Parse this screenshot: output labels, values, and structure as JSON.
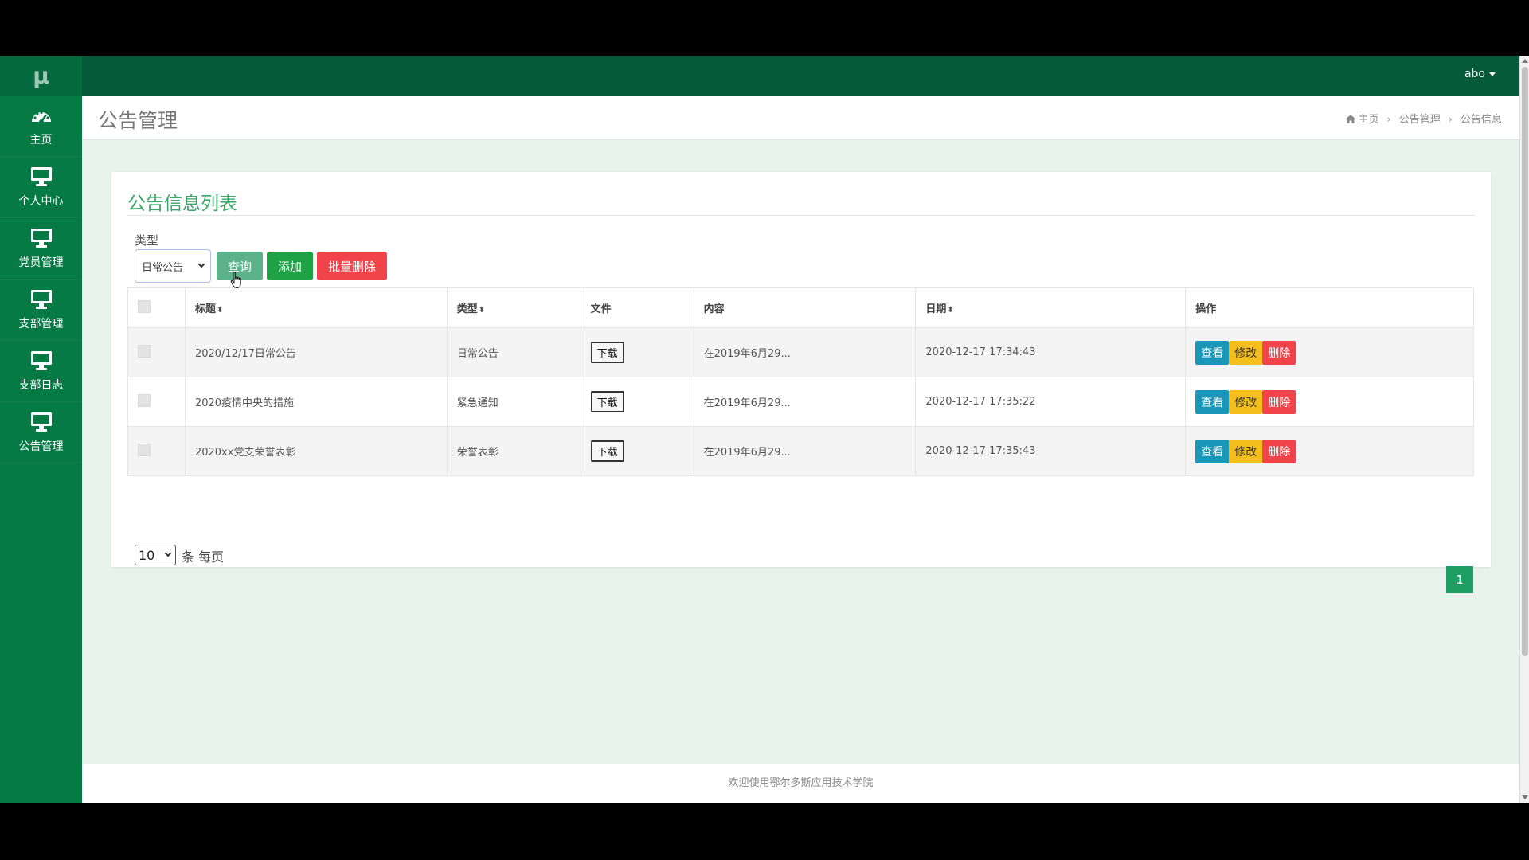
{
  "app": {
    "logo": "μ",
    "user": "abo"
  },
  "sidebar": {
    "items": [
      {
        "label": "主页",
        "icon": "dashboard-icon"
      },
      {
        "label": "个人中心",
        "icon": "monitor-icon"
      },
      {
        "label": "党员管理",
        "icon": "monitor-icon"
      },
      {
        "label": "支部管理",
        "icon": "monitor-icon"
      },
      {
        "label": "支部日志",
        "icon": "monitor-icon"
      },
      {
        "label": "公告管理",
        "icon": "monitor-icon"
      }
    ]
  },
  "header": {
    "title": "公告管理",
    "breadcrumb": [
      "主页",
      "公告管理",
      "公告信息"
    ]
  },
  "card": {
    "title": "公告信息列表",
    "filter_label": "类型",
    "filter_value": "日常公告",
    "query_button": "查询",
    "add_button": "添加",
    "batch_delete_button": "批量删除"
  },
  "table": {
    "columns": [
      "标题",
      "类型",
      "文件",
      "内容",
      "日期",
      "操作"
    ],
    "sortable": {
      "标题": true,
      "类型": true,
      "日期": true
    },
    "rows": [
      {
        "title": "2020/12/17日常公告",
        "type": "日常公告",
        "file": "下载",
        "content": "在2019年6月29...",
        "date": "2020-12-17 17:34:43"
      },
      {
        "title": "2020疫情中央的措施",
        "type": "紧急通知",
        "file": "下载",
        "content": "在2019年6月29...",
        "date": "2020-12-17 17:35:22"
      },
      {
        "title": "2020xx党支荣誉表彰",
        "type": "荣誉表彰",
        "file": "下载",
        "content": "在2019年6月29...",
        "date": "2020-12-17 17:35:43"
      }
    ],
    "actions": {
      "view": "查看",
      "edit": "修改",
      "delete": "删除"
    }
  },
  "pager": {
    "page_size": "10",
    "suffix": "条 每页",
    "current_page": "1"
  },
  "footer": {
    "text": "欢迎使用鄂尔多斯应用技术学院"
  },
  "colors": {
    "sidebar": "#057a45",
    "topbar": "#045a3b",
    "accent": "#1e9e62",
    "danger": "#f0444a",
    "warning": "#f4be1c",
    "info": "#1996b8"
  }
}
